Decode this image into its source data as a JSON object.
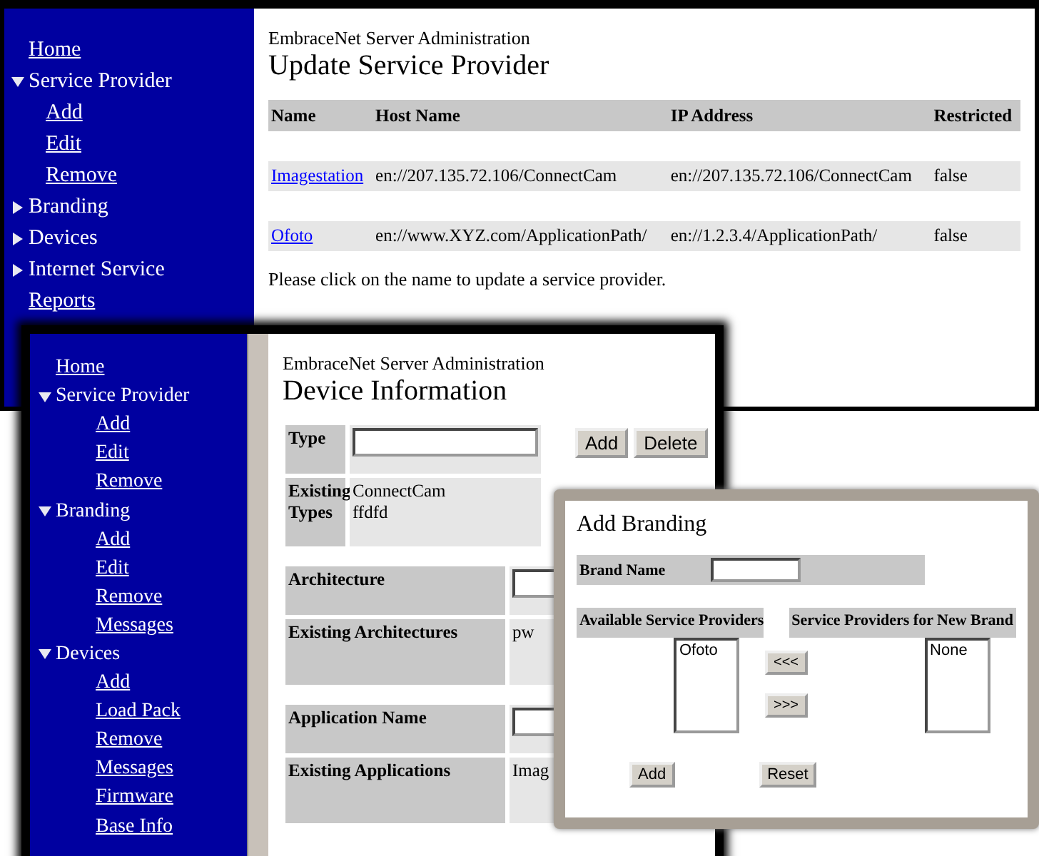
{
  "windows": [
    {
      "kind": "provider_list",
      "sidebar": [
        {
          "label": "Home",
          "kind": "link"
        },
        {
          "label": "Service Provider",
          "kind": "section",
          "expanded": true,
          "children": [
            {
              "label": "Add",
              "kind": "link"
            },
            {
              "label": "Edit",
              "kind": "link"
            },
            {
              "label": "Remove",
              "kind": "link"
            }
          ]
        },
        {
          "label": "Branding",
          "kind": "section",
          "expanded": false
        },
        {
          "label": "Devices",
          "kind": "section",
          "expanded": false
        },
        {
          "label": "Internet Service",
          "kind": "section",
          "expanded": false
        },
        {
          "label": "Reports",
          "kind": "link"
        }
      ],
      "app_title": "EmbraceNet Server Administration",
      "heading": "Update Service Provider",
      "table": {
        "columns": [
          "Name",
          "Host Name",
          "IP Address",
          "Restricted"
        ],
        "rows": [
          {
            "name": "Imagestation",
            "host": "en://207.135.72.106/ConnectCam",
            "ip": "en://207.135.72.106/ConnectCam",
            "restricted": "false"
          },
          {
            "name": "Ofoto",
            "host": "en://www.XYZ.com/ApplicationPath/",
            "ip": "en://1.2.3.4/ApplicationPath/",
            "restricted": "false"
          }
        ]
      },
      "note": "Please click on the name to update a service provider."
    },
    {
      "kind": "device_info",
      "sidebar": [
        {
          "label": "Home",
          "kind": "link"
        },
        {
          "label": "Service Provider",
          "kind": "section",
          "expanded": true,
          "children": [
            {
              "label": "Add",
              "kind": "link"
            },
            {
              "label": "Edit",
              "kind": "link"
            },
            {
              "label": "Remove",
              "kind": "link"
            }
          ]
        },
        {
          "label": "Branding",
          "kind": "section",
          "expanded": true,
          "children": [
            {
              "label": "Add",
              "kind": "link"
            },
            {
              "label": "Edit",
              "kind": "link"
            },
            {
              "label": "Remove",
              "kind": "link"
            },
            {
              "label": "Messages",
              "kind": "link"
            }
          ]
        },
        {
          "label": "Devices",
          "kind": "section",
          "expanded": true,
          "children": [
            {
              "label": "Add",
              "kind": "link"
            },
            {
              "label": "Load Pack",
              "kind": "link"
            },
            {
              "label": "Remove",
              "kind": "link"
            },
            {
              "label": "Messages",
              "kind": "link"
            },
            {
              "label": "Firmware",
              "kind": "link"
            },
            {
              "label": "Base Info",
              "kind": "link"
            }
          ]
        }
      ],
      "app_title": "EmbraceNet Server Administration",
      "heading": "Device Information",
      "type_block": {
        "label": "Type",
        "existing_label": "Existing Types",
        "existing": [
          "ConnectCam",
          "ffdfd"
        ],
        "buttons": [
          "Add",
          "Delete"
        ]
      },
      "blocks": [
        {
          "label": "Architecture",
          "existing_label": "Existing Architectures",
          "existing": "pw"
        },
        {
          "label": "Application Name",
          "existing_label": "Existing Applications",
          "existing": "Imag"
        }
      ]
    },
    {
      "kind": "add_branding",
      "heading": "Add Branding",
      "brand_label": "Brand Name",
      "available_label": "Available Service Providers",
      "selected_label": "Service Providers for New Brand",
      "available": [
        "Ofoto"
      ],
      "selected": [
        "None"
      ],
      "move_buttons": [
        "<<<",
        ">>>"
      ],
      "buttons": [
        "Add",
        "Reset"
      ]
    }
  ]
}
